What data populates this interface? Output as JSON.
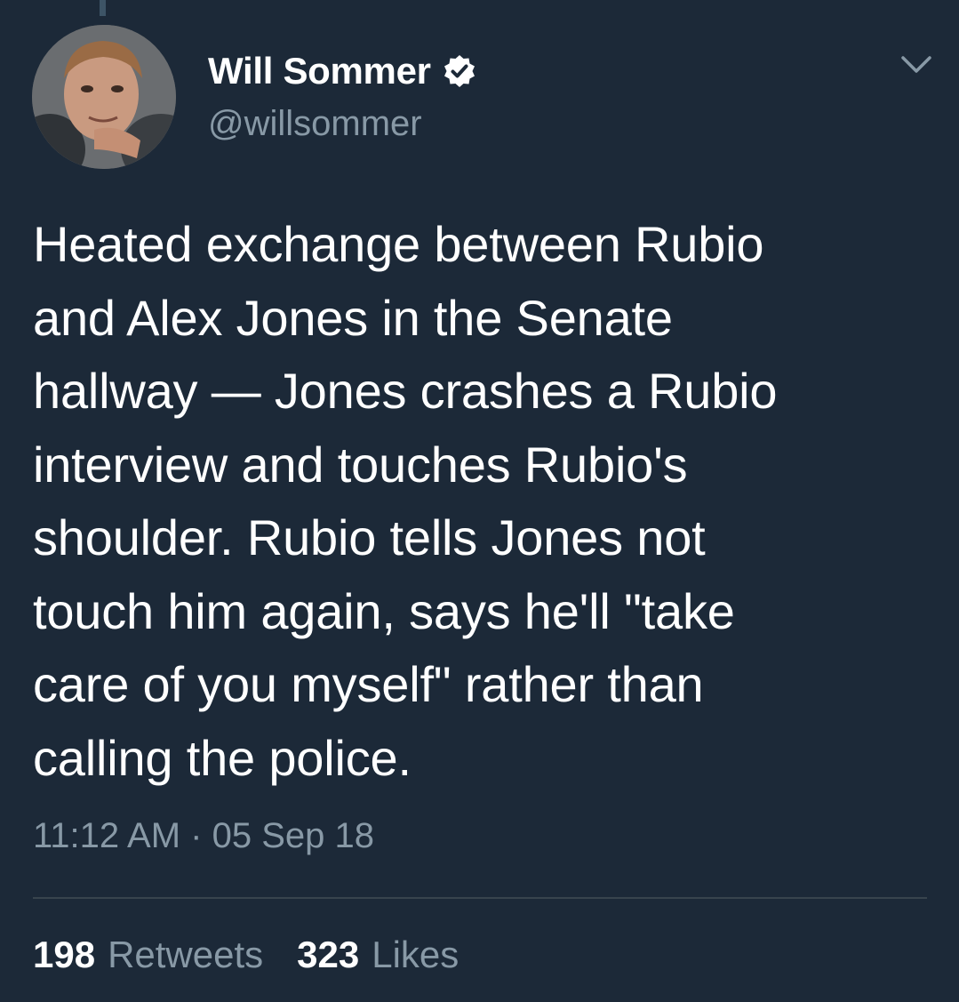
{
  "tweet": {
    "author": {
      "display_name": "Will Sommer",
      "handle": "@willsommer",
      "verified": true,
      "avatar_icon": "avatar-photo"
    },
    "text_lines": [
      "Heated exchange between Rubio",
      "and Alex Jones in the Senate",
      "hallway — Jones crashes a Rubio",
      "interview and touches Rubio's",
      "shoulder. Rubio tells Jones not",
      "touch him again, says he'll \"take",
      "care of you myself\" rather than",
      "calling the police."
    ],
    "timestamp": "11:12 AM · 05 Sep 18",
    "stats": {
      "retweets_count": "198",
      "retweets_label": "Retweets",
      "likes_count": "323",
      "likes_label": "Likes"
    },
    "menu_icon": "chevron-down-icon"
  },
  "colors": {
    "background": "#1c2938",
    "primary_text": "#ffffff",
    "secondary_text": "#8899a6",
    "divider": "#38444d",
    "verified_badge": "#ffffff"
  }
}
